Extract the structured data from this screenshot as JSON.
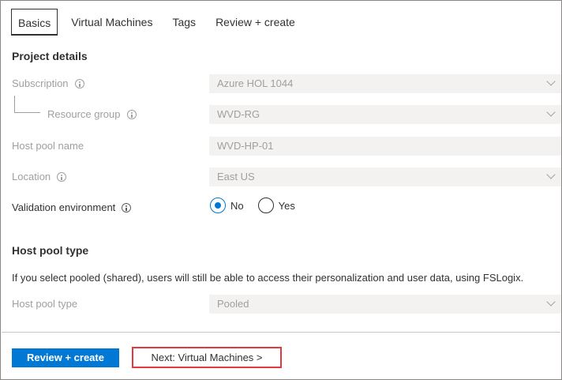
{
  "tabs": [
    {
      "label": "Basics"
    },
    {
      "label": "Virtual Machines"
    },
    {
      "label": "Tags"
    },
    {
      "label": "Review + create"
    }
  ],
  "project_details": {
    "title": "Project details",
    "subscription": {
      "label": "Subscription",
      "value": "Azure HOL 1044"
    },
    "resource_group": {
      "label": "Resource group",
      "value": "WVD-RG"
    },
    "host_pool_name": {
      "label": "Host pool name",
      "value": "WVD-HP-01"
    },
    "location": {
      "label": "Location",
      "value": "East US"
    },
    "validation": {
      "label": "Validation environment",
      "options": [
        "No",
        "Yes"
      ],
      "selected": "No"
    }
  },
  "host_pool_type": {
    "title": "Host pool type",
    "description": "If you select pooled (shared), users will still be able to access their personalization and user data, using FSLogix.",
    "field": {
      "label": "Host pool type",
      "value": "Pooled"
    }
  },
  "footer": {
    "review_create": "Review + create",
    "next": "Next: Virtual Machines >"
  },
  "colors": {
    "accent": "#0078d4",
    "highlight_border": "#e0393e",
    "disabled_field": "#f3f2f1",
    "disabled_text": "#a19f9d"
  }
}
